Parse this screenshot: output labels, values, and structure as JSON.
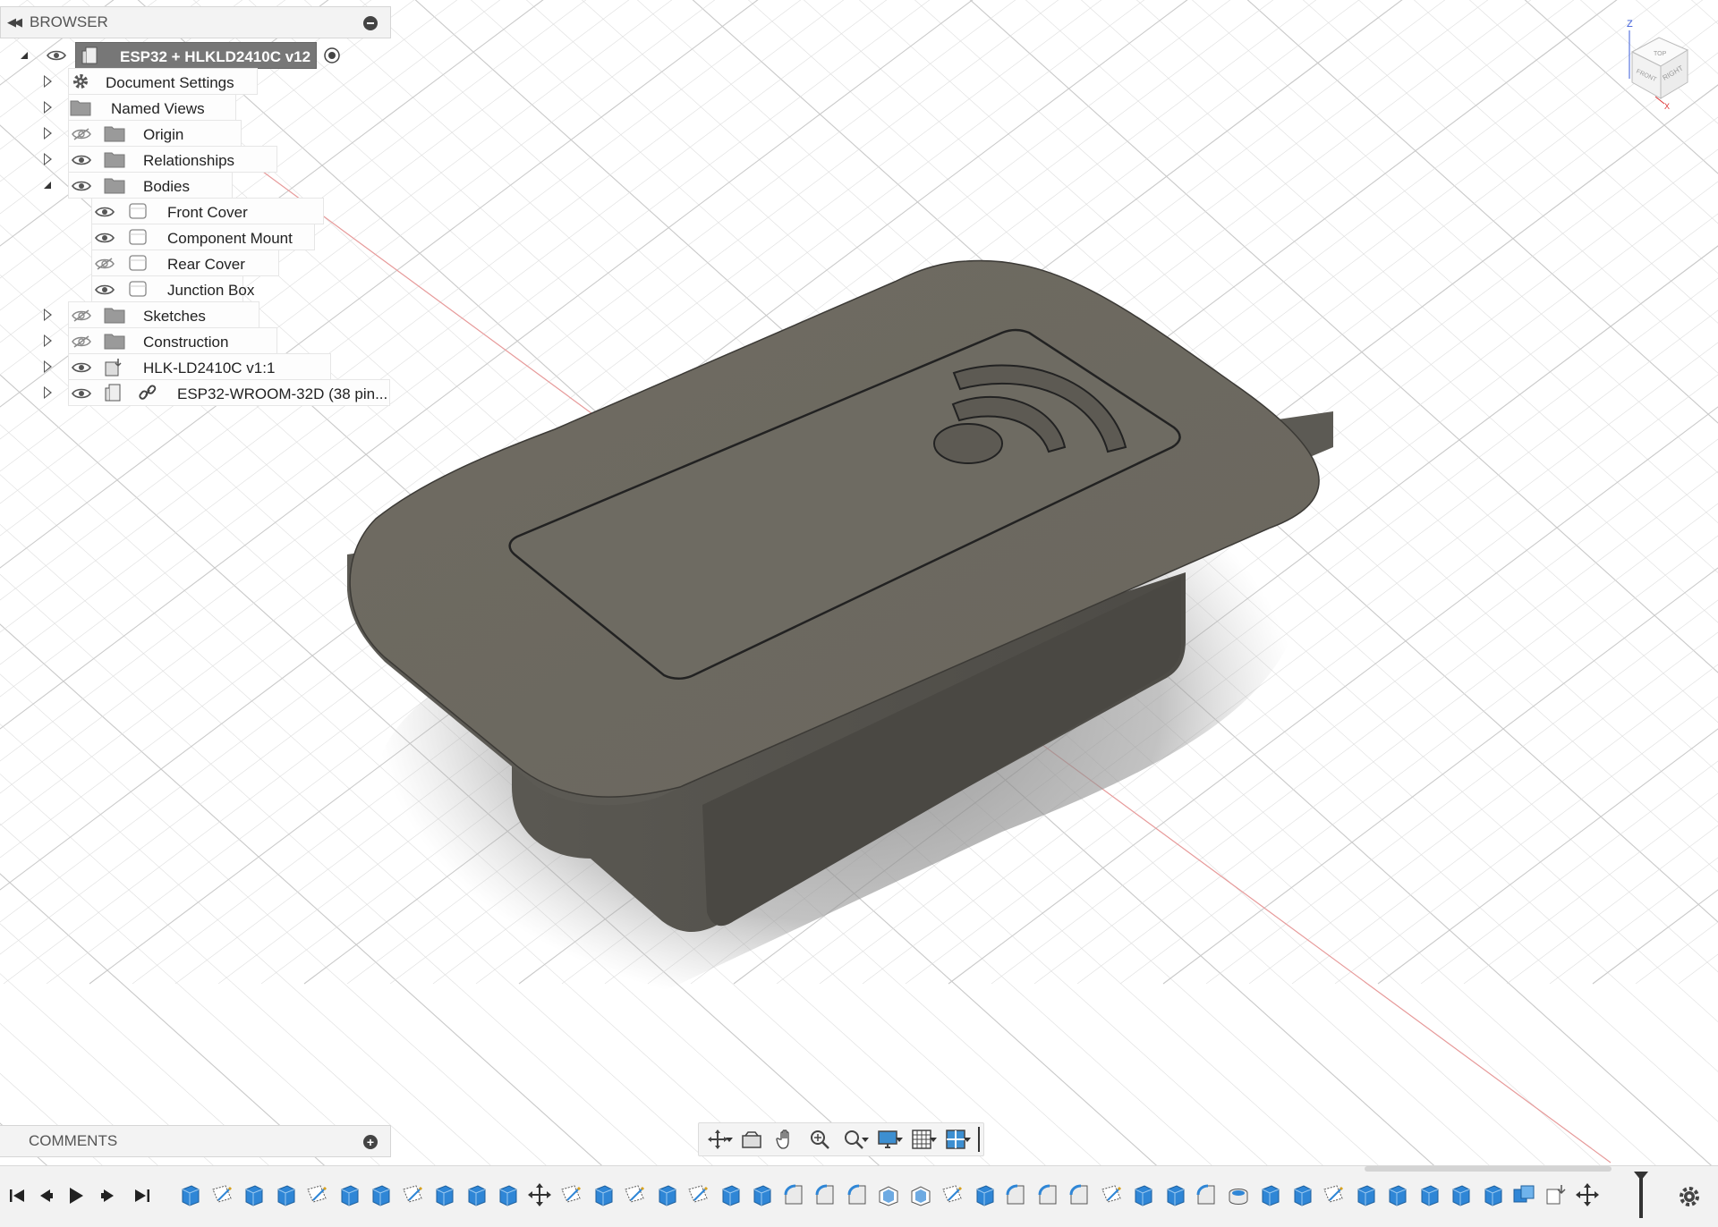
{
  "browser": {
    "title": "BROWSER",
    "root": {
      "label": "ESP32 + HLKLD2410C v12"
    },
    "items": [
      {
        "label": "Document Settings",
        "icon": "gear-icon",
        "expanded": false
      },
      {
        "label": "Named Views",
        "icon": "folder-icon",
        "expanded": false
      },
      {
        "label": "Origin",
        "icon": "folder-icon",
        "visible": false,
        "expanded": false
      },
      {
        "label": "Relationships",
        "icon": "folder-icon",
        "visible": true,
        "expanded": false
      },
      {
        "label": "Bodies",
        "icon": "folder-icon",
        "visible": true,
        "expanded": true,
        "children": [
          {
            "label": "Front Cover",
            "visible": true
          },
          {
            "label": "Component Mount",
            "visible": true
          },
          {
            "label": "Rear Cover",
            "visible": false
          },
          {
            "label": "Junction Box",
            "visible": true
          }
        ]
      },
      {
        "label": "Sketches",
        "icon": "folder-icon",
        "visible": false,
        "expanded": false
      },
      {
        "label": "Construction",
        "icon": "folder-icon",
        "visible": false,
        "expanded": false
      },
      {
        "label": "HLK-LD2410C v1:1",
        "icon": "component-icon",
        "visible": true,
        "expanded": false
      },
      {
        "label": "ESP32-WROOM-32D (38 pin...",
        "icon": "linked-component-icon",
        "visible": true,
        "expanded": false
      }
    ]
  },
  "comments": {
    "title": "COMMENTS"
  },
  "navbar": {
    "tools": [
      "orbit-icon",
      "look-at-icon",
      "pan-icon",
      "zoom-icon",
      "fit-icon",
      "display-settings-icon",
      "grid-settings-icon",
      "viewports-icon"
    ]
  },
  "viewcube": {
    "labels": {
      "top": "TOP",
      "front": "FRONT",
      "right": "RIGHT"
    },
    "axis": {
      "z": "Z",
      "x": "X"
    }
  },
  "timeline": {
    "controls": [
      "go-to-start-icon",
      "step-back-icon",
      "play-icon",
      "step-forward-icon",
      "go-to-end-icon"
    ],
    "features": [
      "extrude",
      "sketch",
      "extrude",
      "extrude",
      "sketch",
      "extrude",
      "extrude",
      "sketch",
      "extrude",
      "extrude",
      "extrude",
      "move",
      "sketch",
      "extrude",
      "sketch",
      "extrude",
      "sketch",
      "extrude",
      "extrude",
      "fillet",
      "fillet",
      "fillet",
      "shell",
      "shell",
      "sketch",
      "extrude",
      "fillet",
      "fillet",
      "fillet",
      "sketch",
      "extrude",
      "extrude",
      "fillet",
      "hole",
      "extrude",
      "extrude",
      "sketch",
      "extrude",
      "extrude",
      "extrude",
      "extrude",
      "extrude",
      "combine",
      "component",
      "move"
    ]
  },
  "colors": {
    "body": "#6e6b62",
    "grid": "#d9d9d9",
    "accent": "#3d8fd1",
    "root_bg": "#777777"
  }
}
